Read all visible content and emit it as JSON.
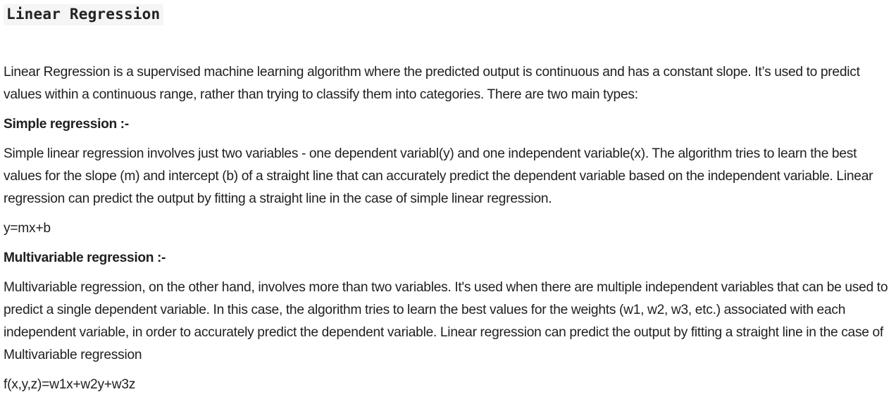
{
  "title": "Linear Regression",
  "intro": "Linear Regression is a supervised machine learning algorithm where the predicted output is continuous and has a constant slope. It’s used to predict values within a continuous range, rather than trying to classify them into categories. There are two main types:",
  "simple": {
    "heading": "Simple regression :-",
    "body": "Simple linear regression involves just two variables - one dependent variabl(y) and one independent variable(x). The algorithm tries to learn the best values for the slope (m) and intercept (b) of a straight line that can accurately predict the dependent variable based on the independent variable. Linear regression can predict the output by fitting a straight line in the case of simple linear regression.",
    "equation": "y=mx+b"
  },
  "multi": {
    "heading": "Multivariable regression :-",
    "body": "Multivariable regression, on the other hand, involves more than two variables. It's used when there are multiple independent variables that can be used to predict a single dependent variable. In this case, the algorithm tries to learn the best values for the weights (w1, w2, w3, etc.) associated with each independent variable, in order to accurately predict the dependent variable. Linear regression can predict the output by fitting a straight line in the case of Multivariable regression",
    "equation": "f(x,y,z)=w1x+w2y+w3z"
  }
}
